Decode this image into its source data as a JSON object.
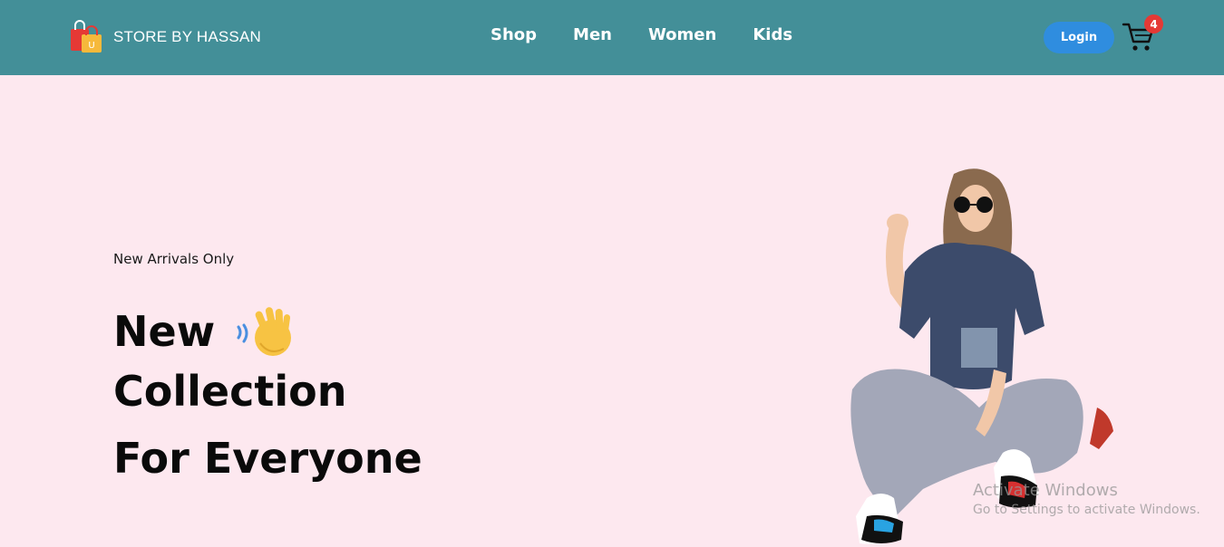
{
  "brand": {
    "name": "STORE BY HASSAN",
    "logo_icon": "shopping-bags-icon"
  },
  "nav": {
    "items": [
      {
        "label": "Shop"
      },
      {
        "label": "Men"
      },
      {
        "label": "Women"
      },
      {
        "label": "Kids"
      }
    ]
  },
  "header": {
    "login_label": "Login",
    "cart_icon": "cart-icon",
    "cart_count": "4"
  },
  "hero": {
    "subtitle": "New Arrivals Only",
    "title_line1": "New",
    "title_line2": "Collection",
    "title_line3": "For Everyone",
    "emoji_icon": "waving-hand-icon"
  },
  "watermark": {
    "title": "Activate Windows",
    "subtitle": "Go to Settings to activate Windows."
  },
  "colors": {
    "navbar": "#438f98",
    "background": "#fde8ef",
    "login_button": "#2f8ddf",
    "badge": "#e53935"
  }
}
